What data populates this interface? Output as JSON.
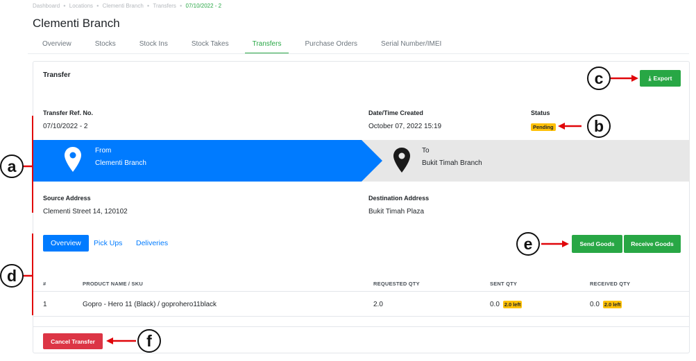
{
  "breadcrumb": [
    "Dashboard",
    "Locations",
    "Clementi Branch",
    "Transfers",
    "07/10/2022 - 2"
  ],
  "page_title": "Clementi Branch",
  "tabs": [
    "Overview",
    "Stocks",
    "Stock Ins",
    "Stock Takes",
    "Transfers",
    "Purchase Orders",
    "Serial Number/IMEI"
  ],
  "active_tab": "Transfers",
  "card": {
    "title": "Transfer",
    "export_label": "Export",
    "ref_label": "Transfer Ref. No.",
    "ref_value": "07/10/2022 - 2",
    "date_label": "Date/Time Created",
    "date_value": "October 07, 2022 15:19",
    "status_label": "Status",
    "status_value": "Pending",
    "from_label": "From",
    "from_value": "Clementi Branch",
    "to_label": "To",
    "to_value": "Bukit Timah Branch",
    "source_label": "Source Address",
    "source_value": "Clementi Street 14, 120102",
    "dest_label": "Destination Address",
    "dest_value": "Bukit Timah Plaza"
  },
  "subtabs": [
    "Overview",
    "Pick Ups",
    "Deliveries"
  ],
  "actions": {
    "send": "Send Goods",
    "receive": "Receive Goods",
    "cancel": "Cancel Transfer"
  },
  "table": {
    "headers": [
      "#",
      "PRODUCT NAME / SKU",
      "REQUESTED QTY",
      "SENT QTY",
      "RECEIVED QTY"
    ],
    "rows": [
      {
        "num": "1",
        "product": "Gopro - Hero 11 (Black) / goprohero11black",
        "requested": "2.0",
        "sent": "0.0",
        "sent_left": "2.0 left",
        "received": "0.0",
        "received_left": "2.0 left"
      }
    ]
  },
  "annotations": [
    "a",
    "b",
    "c",
    "d",
    "e",
    "f"
  ],
  "colors": {
    "primary": "#007bff",
    "success": "#28a745",
    "danger": "#dc3545",
    "warning": "#ffc107",
    "annotation": "#e0060a"
  }
}
